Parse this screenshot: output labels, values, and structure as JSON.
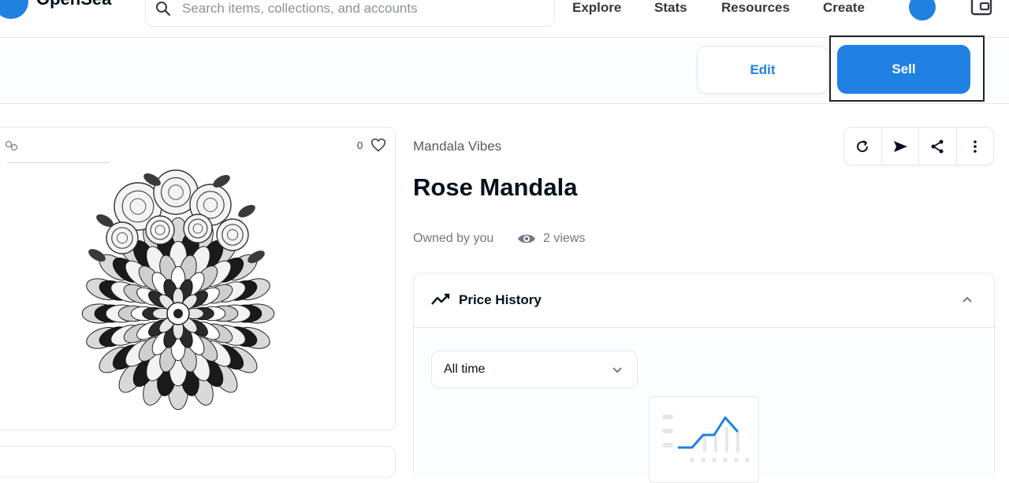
{
  "nav": {
    "brand": "OpenSea",
    "search_placeholder": "Search items, collections, and accounts",
    "links": [
      "Explore",
      "Stats",
      "Resources",
      "Create"
    ]
  },
  "actions": {
    "edit_label": "Edit",
    "sell_label": "Sell"
  },
  "asset_card": {
    "favorite_count": "0"
  },
  "asset": {
    "collection": "Mandala Vibes",
    "title": "Rose Mandala",
    "owner_text": "Owned by you",
    "views_text": "2 views"
  },
  "price_history": {
    "title": "Price History",
    "range_selected": "All time"
  },
  "colors": {
    "accent": "#2081e2",
    "text": "#04111d",
    "muted": "#707a83",
    "border": "#e5e8eb"
  },
  "icons": [
    "search-icon",
    "wallet-icon",
    "chain-icon",
    "heart-icon",
    "eye-icon",
    "refresh-icon",
    "transfer-icon",
    "share-icon",
    "more-icon",
    "trend-icon",
    "chevron-up-icon",
    "chevron-down-icon"
  ]
}
